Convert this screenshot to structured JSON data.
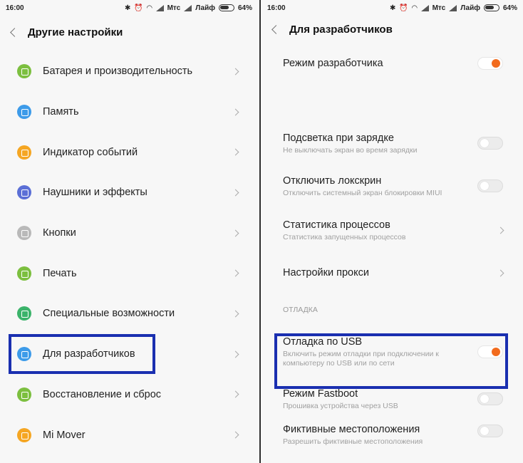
{
  "left": {
    "status": {
      "time": "16:00",
      "carrier1": "Мтс",
      "carrier2": "Лайф",
      "battery": "64%"
    },
    "title": "Другие настройки",
    "items": [
      {
        "label": "Батарея и производительность",
        "icon": "battery-icon",
        "color": "#7cbf3f"
      },
      {
        "label": "Память",
        "icon": "storage-icon",
        "color": "#3d9be9"
      },
      {
        "label": "Индикатор событий",
        "icon": "notification-light-icon",
        "color": "#f5a623"
      },
      {
        "label": "Наушники и эффекты",
        "icon": "headphones-icon",
        "color": "#5b6fd6"
      },
      {
        "label": "Кнопки",
        "icon": "buttons-icon",
        "color": "#b9b9b9"
      },
      {
        "label": "Печать",
        "icon": "printer-icon",
        "color": "#7cbf3f"
      },
      {
        "label": "Специальные возможности",
        "icon": "accessibility-icon",
        "color": "#3bb36a"
      },
      {
        "label": "Для разработчиков",
        "icon": "developer-icon",
        "color": "#3d9be9"
      },
      {
        "label": "Восстановление и сброс",
        "icon": "backup-icon",
        "color": "#7cbf3f"
      },
      {
        "label": "Mi Mover",
        "icon": "mi-mover-icon",
        "color": "#f5a623"
      }
    ]
  },
  "right": {
    "status": {
      "time": "16:00",
      "carrier1": "Мтс",
      "carrier2": "Лайф",
      "battery": "64%"
    },
    "title": "Для разработчиков",
    "dev_mode": {
      "title": "Режим разработчика",
      "on": true
    },
    "charge_light": {
      "title": "Подсветка при зарядке",
      "sub": "Не выключать экран во время зарядки",
      "on": false
    },
    "lockscreen": {
      "title": "Отключить локскрин",
      "sub": "Отключить системный экран блокировки MIUI",
      "on": false
    },
    "process_stats": {
      "title": "Статистика процессов",
      "sub": "Статистика запущенных процессов"
    },
    "proxy": {
      "title": "Настройки прокси"
    },
    "section_debug": "ОТЛАДКА",
    "usb_debug": {
      "title": "Отладка по USB",
      "sub": "Включить режим отладки при подключении к компьютеру по USB или по сети",
      "on": true
    },
    "fastboot": {
      "title": "Режим Fastboot",
      "sub": "Прошивка устройства через USB",
      "on": false
    },
    "mock_location": {
      "title": "Фиктивные местоположения",
      "sub": "Разрешить фиктивные местоположения",
      "on": false
    }
  },
  "colors": {
    "accent": "#f26b1d",
    "highlight": "#1a2fb0"
  }
}
